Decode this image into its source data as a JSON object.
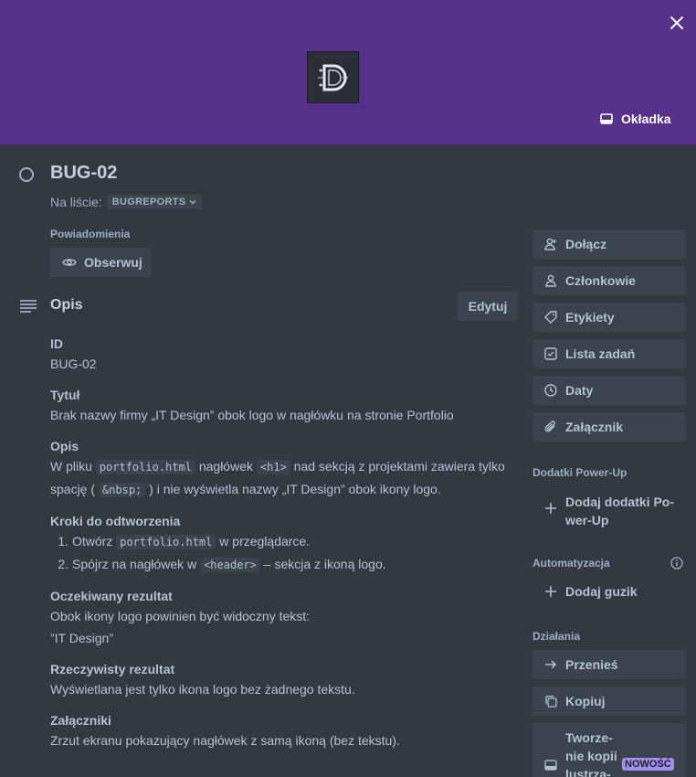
{
  "cover": {
    "button_label": "Okładka",
    "cover_color": "#56308a"
  },
  "card": {
    "title": "BUG-02",
    "list_prefix": "Na liście:",
    "list_name": "BUGREPORTS",
    "notifications_label": "Powiadomienia",
    "watch_label": "Obserwuj"
  },
  "description": {
    "heading": "Opis",
    "edit_label": "Edytuj",
    "sections": {
      "id_heading": "ID",
      "id_value": "BUG-02",
      "title_heading": "Tytuł",
      "title_value": "Brak nazwy firmy „IT Design” obok logo w nagłówku na stronie Portfolio",
      "opis_heading": "Opis",
      "opis_t1": "W pliku ",
      "opis_code1": "portfolio.html",
      "opis_t2": " nagłówek ",
      "opis_code2": "<h1>",
      "opis_t3": " nad sekcją z projektami zawiera tylko spację (",
      "opis_code3": "&nbsp;",
      "opis_t4": ") i nie wyświetla nazwy „IT Design” obok ikony logo.",
      "steps_heading": "Kroki do odtworzenia",
      "step1_t1": "Otwórz ",
      "step1_code": "portfolio.html",
      "step1_t2": " w przeglądarce.",
      "step2_t1": "Spójrz na nagłówek w ",
      "step2_code": "<header>",
      "step2_t2": " – sekcja z ikoną logo.",
      "expected_heading": "Oczekiwany rezultat",
      "expected_line1": "Obok ikony logo powinien być widoczny tekst:",
      "expected_line2": "”IT Design”",
      "actual_heading": "Rzeczywisty rezultat",
      "actual_value": "Wyświetlana jest tylko ikona logo bez żadnego tekstu.",
      "attach_heading": "Załączniki",
      "attach_value": "Zrzut ekranu pokazujący nagłówek z samą ikoną (bez tekstu)."
    }
  },
  "sidebar": {
    "buttons": {
      "join": "Dołącz",
      "members": "Członkowie",
      "labels": "Etykiety",
      "checklist": "Lista zadań",
      "dates": "Daty",
      "attachment": "Załącznik"
    },
    "powerups_label": "Dodatki Power-Up",
    "add_powerups_line1": "Dodaj dodatki Po-",
    "add_powerups_line2": "wer-Up",
    "automation_label": "Automatyzacja",
    "add_button": "Dodaj guzik",
    "actions_label": "Działania",
    "move": "Przenieś",
    "copy": "Kopiuj",
    "mirror_line1": "Tworze-",
    "mirror_line2": "nie kopii",
    "mirror_line3": "lustrza-",
    "new_badge": "NOWOŚĆ"
  }
}
